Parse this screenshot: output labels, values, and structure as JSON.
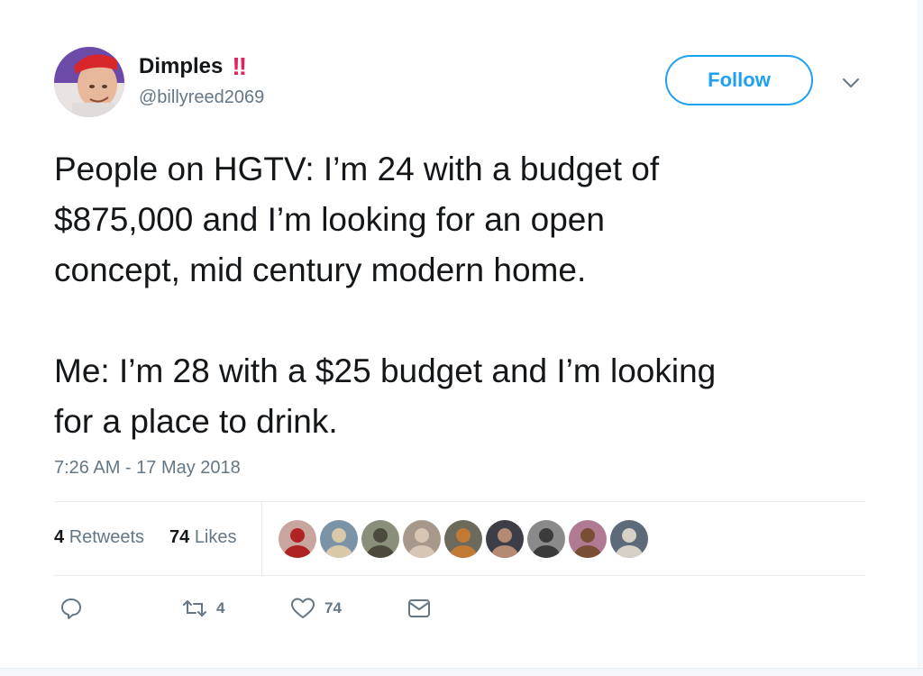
{
  "user": {
    "display_name": "Dimples",
    "name_emoji": "!!",
    "handle": "@billyreed2069"
  },
  "follow_label": "Follow",
  "tweet": {
    "text": "People on HGTV: I’m 24 with a budget of\n$875,000 and I’m looking for an open\nconcept, mid century modern home.\n\nMe: I’m 28 with a $25 budget and I’m looking\nfor a place to drink.",
    "timestamp": "7:26 AM - 17 May 2018"
  },
  "stats": {
    "retweets_count": "4",
    "retweets_label": "Retweets",
    "likes_count": "74",
    "likes_label": "Likes"
  },
  "liker_avatars": [
    {
      "bg": "#c9a5a0",
      "fg": "#b02323"
    },
    {
      "bg": "#7a93a6",
      "fg": "#d9c9a8"
    },
    {
      "bg": "#8a8f7a",
      "fg": "#4c4a3d"
    },
    {
      "bg": "#a7988c",
      "fg": "#d8c6b4"
    },
    {
      "bg": "#6b6a5c",
      "fg": "#c07a36"
    },
    {
      "bg": "#3d3d48",
      "fg": "#b48a72"
    },
    {
      "bg": "#8a8a8a",
      "fg": "#3b3b3b"
    },
    {
      "bg": "#b07a92",
      "fg": "#7a4e35"
    },
    {
      "bg": "#5c6a7a",
      "fg": "#d7d0c6"
    }
  ],
  "actions": {
    "reply_icon": "reply-icon",
    "retweet_icon": "retweet-icon",
    "retweet_count": "4",
    "like_icon": "heart-icon",
    "like_count": "74",
    "dm_icon": "envelope-icon"
  },
  "colors": {
    "accent": "#1da1f2",
    "text": "#14171a",
    "muted": "#657786",
    "emoji": "#e0245e"
  }
}
